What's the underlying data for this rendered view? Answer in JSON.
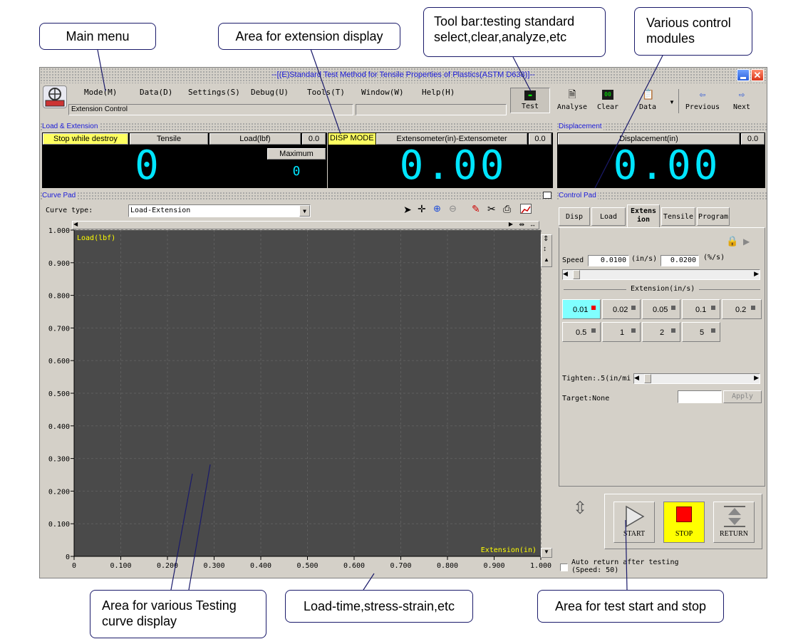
{
  "window": {
    "title": "--[(E)Standard Test Method for Tensile Properties of Plastics(ASTM D638)]--",
    "status_text": "Extension Control"
  },
  "menu": [
    {
      "label": "Mode(M)"
    },
    {
      "label": "Data(D)"
    },
    {
      "label": "Settings(S)"
    },
    {
      "label": "Debug(U)"
    },
    {
      "label": "Tools(T)"
    },
    {
      "label": "Window(W)"
    },
    {
      "label": "Help(H)"
    }
  ],
  "toolbar": {
    "test": "Test",
    "analyse": "Analyse",
    "clear": "Clear",
    "data": "Data",
    "previous": "Previous",
    "next": "Next"
  },
  "load_extension": {
    "title": "Load & Extension",
    "stop_mode": "Stop while destroy",
    "test_type": "Tensile",
    "load_unit": "Load(lbf)",
    "load_small": "0.0",
    "maximum_label": "Maximum",
    "load_value": "0",
    "max_value": "0",
    "disp_mode": "DISP MODE",
    "extensometer": "Extensometer(in)-Extensometer",
    "ext_small": "0.0",
    "ext_value": "0.00"
  },
  "displacement": {
    "title": "Displacement",
    "unit": "Displacement(in)",
    "small": "0.0",
    "value": "0.00"
  },
  "curve_pad": {
    "title": "Curve Pad",
    "curve_type_label": "Curve type:",
    "curve_type_value": "Load-Extension"
  },
  "chart_data": {
    "type": "line",
    "ylabel": "Load(lbf)",
    "xlabel": "Extension(in)",
    "xlim": [
      0,
      1.0
    ],
    "ylim": [
      0,
      1.0
    ],
    "x_ticks": [
      "0",
      "0.100",
      "0.200",
      "0.300",
      "0.400",
      "0.500",
      "0.600",
      "0.700",
      "0.800",
      "0.900",
      "1.000"
    ],
    "y_ticks": [
      "0",
      "0.100",
      "0.200",
      "0.300",
      "0.400",
      "0.500",
      "0.600",
      "0.700",
      "0.800",
      "0.900",
      "1.000"
    ],
    "grid": true,
    "series": [],
    "background": "#4a4a4a",
    "label_color": "#ffff00"
  },
  "control_pad": {
    "title": "Control Pad",
    "tabs": [
      {
        "label": "Disp"
      },
      {
        "label": "Load"
      },
      {
        "label": "Extens ion"
      },
      {
        "label": "Tensile"
      },
      {
        "label": "Program"
      }
    ],
    "speed_label": "Speed",
    "speed_value": "0.0100",
    "speed_unit": "(in/s)",
    "speed_pct_value": "0.0200",
    "speed_pct_unit": "(%/s)",
    "extension_group": "Extension(in/s)",
    "speeds": [
      "0.01",
      "0.02",
      "0.05",
      "0.1",
      "0.2",
      "0.5",
      "1",
      "2",
      "5"
    ],
    "tighten_label": "Tighten:.5(in/mi",
    "target_label": "Target:None",
    "apply": "Apply",
    "start": "START",
    "stop": "STOP",
    "return": "RETURN",
    "auto_return": "Auto return after testing",
    "auto_return_speed": "(Speed: 50)"
  },
  "callouts": {
    "main_menu": "Main menu",
    "extension_display": "Area for extension display",
    "toolbar_line1": "Tool bar:testing standard",
    "toolbar_line2": "select,clear,analyze,etc",
    "control_modules_line1": "Various control",
    "control_modules_line2": "modules",
    "curve_display_line1": "Area for various Testing",
    "curve_display_line2": "curve display",
    "curve_types": "Load-time,stress-strain,etc",
    "start_stop": "Area for test start and stop"
  },
  "colors": {
    "title_text": "#1a1ad8",
    "yellow_highlight": "#ffff60",
    "lcd_digit": "#00e5ff",
    "stop_button": "#ffff00",
    "stop_square": "#ff0000",
    "selected_speed": "#80ffff"
  }
}
